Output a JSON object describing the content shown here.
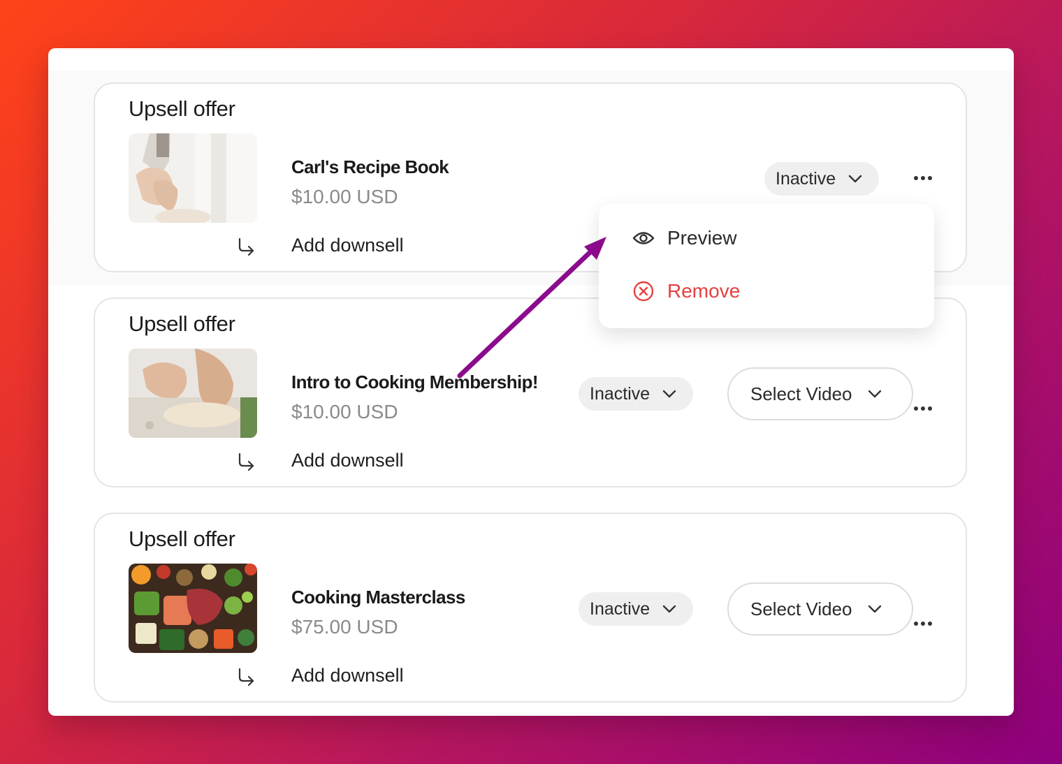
{
  "colors": {
    "accent_red": "#e5403f",
    "annotation_arrow": "#8b0b8c",
    "status_pill_bg": "#efefef"
  },
  "offers": [
    {
      "section_title": "Upsell offer",
      "product_name": "Carl's Recipe Book",
      "price": "$10.00 USD",
      "status": "Inactive",
      "downsell_label": "Add downsell",
      "image": "kneading-dough-icon"
    },
    {
      "section_title": "Upsell offer",
      "product_name": "Intro to Cooking Membership!",
      "price": "$10.00 USD",
      "status": "Inactive",
      "video_select": "Select Video",
      "downsell_label": "Add downsell",
      "image": "hands-flour-icon"
    },
    {
      "section_title": "Upsell offer",
      "product_name": "Cooking Masterclass",
      "price": "$75.00 USD",
      "status": "Inactive",
      "video_select": "Select Video",
      "downsell_label": "Add downsell",
      "image": "food-spread-icon"
    }
  ],
  "menu": {
    "items": [
      {
        "label": "Preview",
        "icon": "eye-icon"
      },
      {
        "label": "Remove",
        "icon": "remove-circle-icon"
      }
    ]
  }
}
